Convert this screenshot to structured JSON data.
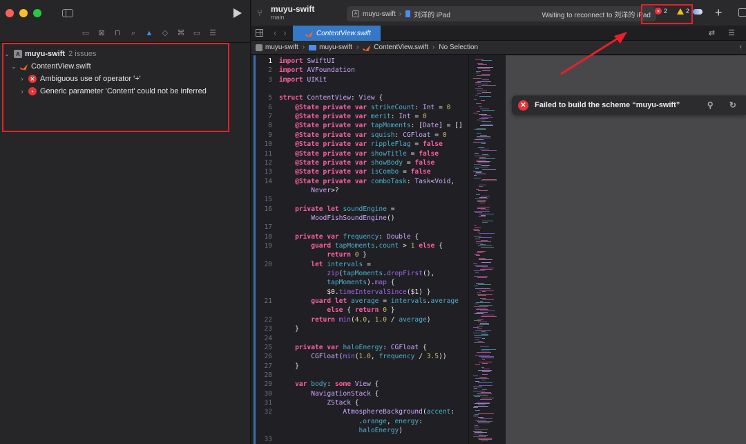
{
  "navigator": {
    "project_name": "muyu-swift",
    "issue_count_label": "2 issues",
    "file_name": "ContentView.swift",
    "issues": [
      {
        "message": "Ambiguous use of operator '+'"
      },
      {
        "message": "Generic parameter 'Content' could not be inferred"
      }
    ],
    "tab_icons": [
      "folder-icon",
      "source-control-icon",
      "bookmark-icon",
      "find-icon",
      "issue-icon",
      "test-icon",
      "debug-icon",
      "breakpoint-icon",
      "report-icon"
    ]
  },
  "toolbar": {
    "scheme": "muyu-swift",
    "branch": "main",
    "destination_scheme": "muyu-swift",
    "destination_device": "刘洋的 iPad",
    "status": "Waiting to reconnect to 刘洋的 iPad",
    "error_count": "2",
    "warning_count": "2"
  },
  "tabs": {
    "active_file": "ContentView.swift"
  },
  "jumpbar": {
    "crumbs": [
      "muyu-swift",
      "muyu-swift",
      "ContentView.swift",
      "No Selection"
    ]
  },
  "toast": {
    "message": "Failed to build the scheme “muyu-swift”"
  },
  "code_lines": [
    {
      "n": "1",
      "cur": true,
      "t": "import SwiftUI"
    },
    {
      "n": "2",
      "t": "import AVFoundation"
    },
    {
      "n": "3",
      "t": "import UIKit"
    },
    {
      "n": "",
      "t": ""
    },
    {
      "n": "5",
      "t": "struct ContentView: View {"
    },
    {
      "n": "6",
      "t": "    @State private var strikeCount: Int = 0"
    },
    {
      "n": "7",
      "t": "    @State private var merit: Int = 0"
    },
    {
      "n": "8",
      "t": "    @State private var tapMoments: [Date] = []"
    },
    {
      "n": "9",
      "t": "    @State private var squish: CGFloat = 0"
    },
    {
      "n": "10",
      "t": "    @State private var rippleFlag = false"
    },
    {
      "n": "11",
      "t": "    @State private var showTitle = false"
    },
    {
      "n": "12",
      "t": "    @State private var showBody = false"
    },
    {
      "n": "13",
      "t": "    @State private var isCombo = false"
    },
    {
      "n": "14",
      "t": "    @State private var comboTask: Task<Void,"
    },
    {
      "n": "",
      "t": "        Never>?"
    },
    {
      "n": "15",
      "t": ""
    },
    {
      "n": "16",
      "t": "    private let soundEngine ="
    },
    {
      "n": "",
      "t": "        WoodFishSoundEngine()"
    },
    {
      "n": "17",
      "t": ""
    },
    {
      "n": "18",
      "t": "    private var frequency: Double {"
    },
    {
      "n": "19",
      "t": "        guard tapMoments.count > 1 else {"
    },
    {
      "n": "",
      "t": "            return 0 }"
    },
    {
      "n": "20",
      "t": "        let intervals ="
    },
    {
      "n": "",
      "t": "            zip(tapMoments.dropFirst(),"
    },
    {
      "n": "",
      "t": "            tapMoments).map {"
    },
    {
      "n": "",
      "t": "            $0.timeIntervalSince($1) }"
    },
    {
      "n": "21",
      "t": "        guard let average = intervals.average"
    },
    {
      "n": "",
      "t": "            else { return 0 }"
    },
    {
      "n": "22",
      "t": "        return min(4.0, 1.0 / average)"
    },
    {
      "n": "23",
      "t": "    }"
    },
    {
      "n": "24",
      "t": ""
    },
    {
      "n": "25",
      "t": "    private var haloEnergy: CGFloat {"
    },
    {
      "n": "26",
      "t": "        CGFloat(min(1.0, frequency / 3.5))"
    },
    {
      "n": "27",
      "t": "    }"
    },
    {
      "n": "28",
      "t": ""
    },
    {
      "n": "29",
      "t": "    var body: some View {"
    },
    {
      "n": "30",
      "t": "        NavigationStack {"
    },
    {
      "n": "31",
      "t": "            ZStack {"
    },
    {
      "n": "32",
      "t": "                AtmosphereBackground(accent:"
    },
    {
      "n": "",
      "t": "                    .orange, energy:"
    },
    {
      "n": "",
      "t": "                    haloEnergy)"
    },
    {
      "n": "33",
      "t": ""
    }
  ],
  "colors": {
    "error": "#e8333a",
    "warning": "#f4c20d",
    "accent": "#3478c7",
    "annotation": "#e8202a"
  }
}
